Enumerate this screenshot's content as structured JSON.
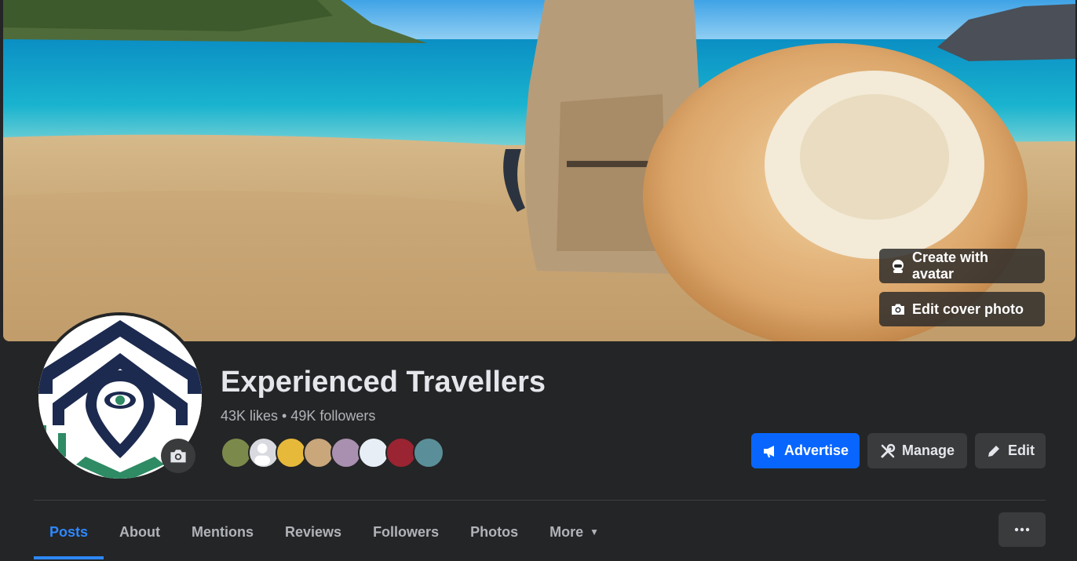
{
  "cover": {
    "create_avatar_label": "Create with avatar",
    "edit_cover_label": "Edit cover photo"
  },
  "page": {
    "name": "Experienced Travellers",
    "likes": "43K likes",
    "separator": " • ",
    "followers": "49K followers"
  },
  "actions": {
    "advertise_label": "Advertise",
    "manage_label": "Manage",
    "edit_label": "Edit"
  },
  "tabs": [
    {
      "label": "Posts",
      "active": true
    },
    {
      "label": "About",
      "active": false
    },
    {
      "label": "Mentions",
      "active": false
    },
    {
      "label": "Reviews",
      "active": false
    },
    {
      "label": "Followers",
      "active": false
    },
    {
      "label": "Photos",
      "active": false
    },
    {
      "label": "More",
      "active": false
    }
  ],
  "icons": {
    "camera": "camera-icon",
    "avatar": "avatar-icon",
    "megaphone": "megaphone-icon",
    "tools": "tools-icon",
    "pencil": "pencil-icon",
    "more": "more-horizontal-icon",
    "caret": "caret-down-icon"
  },
  "colors": {
    "background": "#242526",
    "accent": "#0866ff",
    "tab_active": "#2d88ff",
    "button_secondary": "#3a3b3c"
  }
}
